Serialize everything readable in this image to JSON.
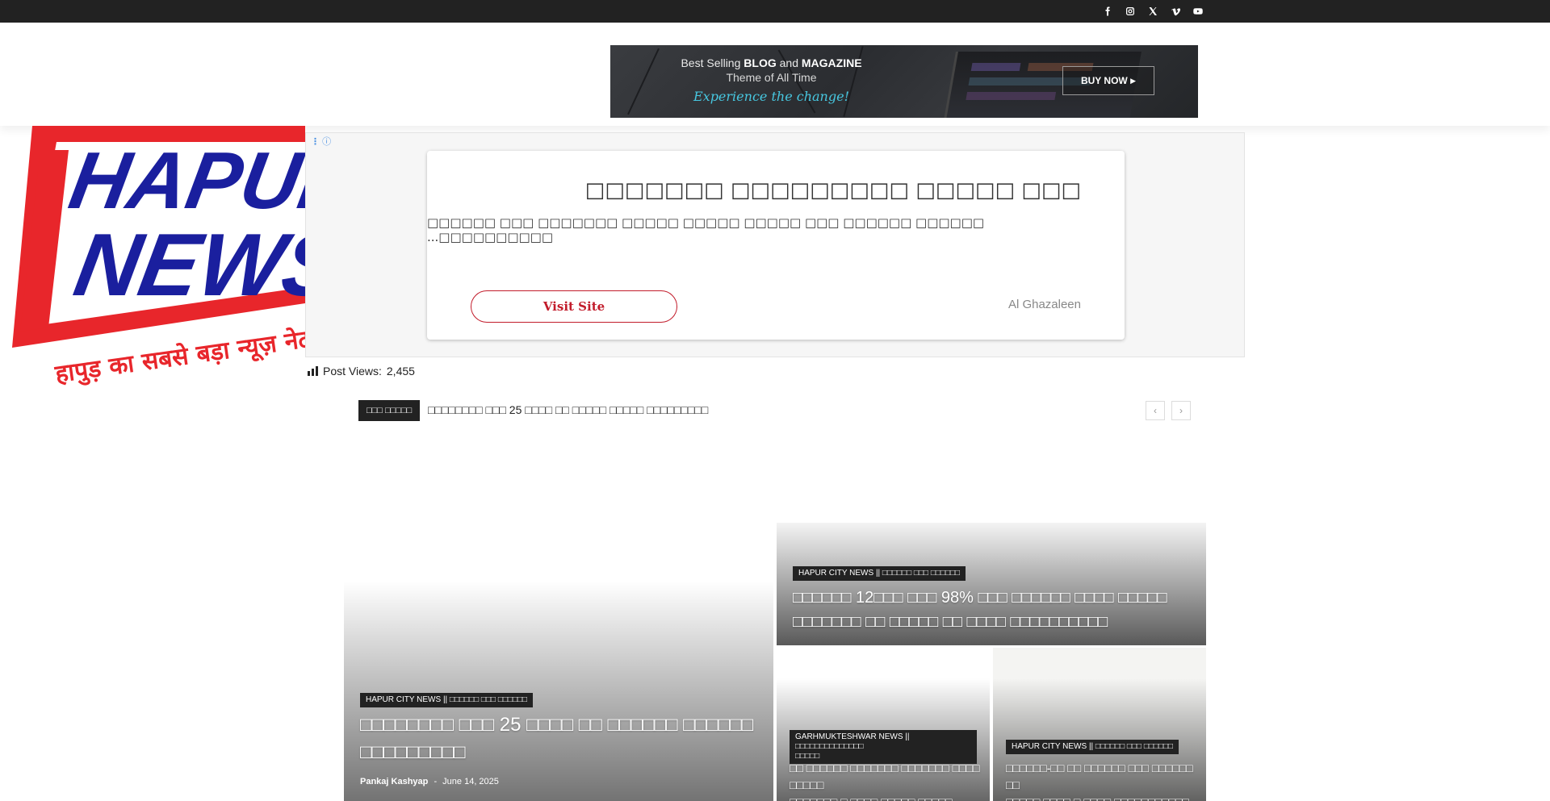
{
  "topbar": {
    "social_icons": [
      "facebook-icon",
      "instagram-icon",
      "x-icon",
      "vimeo-icon",
      "youtube-icon"
    ]
  },
  "promo_banner": {
    "line1_prefix": "Best Selling ",
    "line1_bold1": "BLOG",
    "line1_mid": " and ",
    "line1_bold2": "MAGAZINE",
    "line2": "Theme of All Time",
    "line3": "Experience the change!",
    "button_label": "BUY NOW"
  },
  "logo": {
    "text_top": "HAPUR",
    "text_bottom": "NEWS",
    "tagline": "हापुड़ का सबसे बड़ा न्यूज़ नेटवर्क",
    "colors": {
      "red": "#e8262b",
      "blue": "#1a1f9e"
    }
  },
  "ad": {
    "choices_icon": "info-icon",
    "title": "□□□□□□□ □□□□□□□□□ □□□□□ □□□",
    "description": "□□□□□□ □□□ □□□□□□□ □□□□□ □□□□□ □□□□□ □□□ □□□□□□ □□□□□□ ...□□□□□□□□□□",
    "visit_label": "Visit Site",
    "brand": "Al Ghazaleen"
  },
  "post_views": {
    "label": "Post Views:",
    "count": "2,455"
  },
  "ticker": {
    "label": "□□□ □□□□□",
    "headline": "□□□□□□□□ □□□ 25 □□□□ □□ □□□□□ □□□□□ □□□□□□□□□",
    "prev_icon": "chevron-left-icon",
    "next_icon": "chevron-right-icon"
  },
  "grid": {
    "main": {
      "category": "HAPUR CITY NEWS || □□□□□□ □□□ □□□□□□",
      "title_line1": "□□□□□□□□ □□□ 25 □□□□ □□ □□□□□□ □□□□□□",
      "title_line2": "□□□□□□□□□",
      "author": "Pankaj Kashyap",
      "separator": "-",
      "date": "June 14, 2025"
    },
    "top_right": {
      "category": "HAPUR CITY NEWS || □□□□□□ □□□ □□□□□□",
      "title_line1": "□□□□□□ 12□□□ □□□ 98% □□□ □□□□□□ □□□□ □□□□□",
      "title_line2": "□□□□□□□ □□ □□□□□ □□ □□□□ □□□□□□□□□□"
    },
    "bottom_left": {
      "category_line1": "GARHMUKTESHWAR NEWS || □□□□□□□□□□□□□□",
      "category_line2": "□□□□□",
      "title_line1": "□□ □□□□□□ □□□□□□□ □□□□□□□ □□□□ □□□□□",
      "title_line2": "□□□□□□□ □ □□□□ □□□□□ □□□□□"
    },
    "bottom_right": {
      "category": "HAPUR CITY NEWS || □□□□□□ □□□ □□□□□□",
      "title_line1": "□□□□□□-□□ □□ □□□□□□ □□□ □□□□□□ □□",
      "title_line2": "□□□□□ □□□□ □ □□□□ □□□□□□□□□□□"
    }
  }
}
